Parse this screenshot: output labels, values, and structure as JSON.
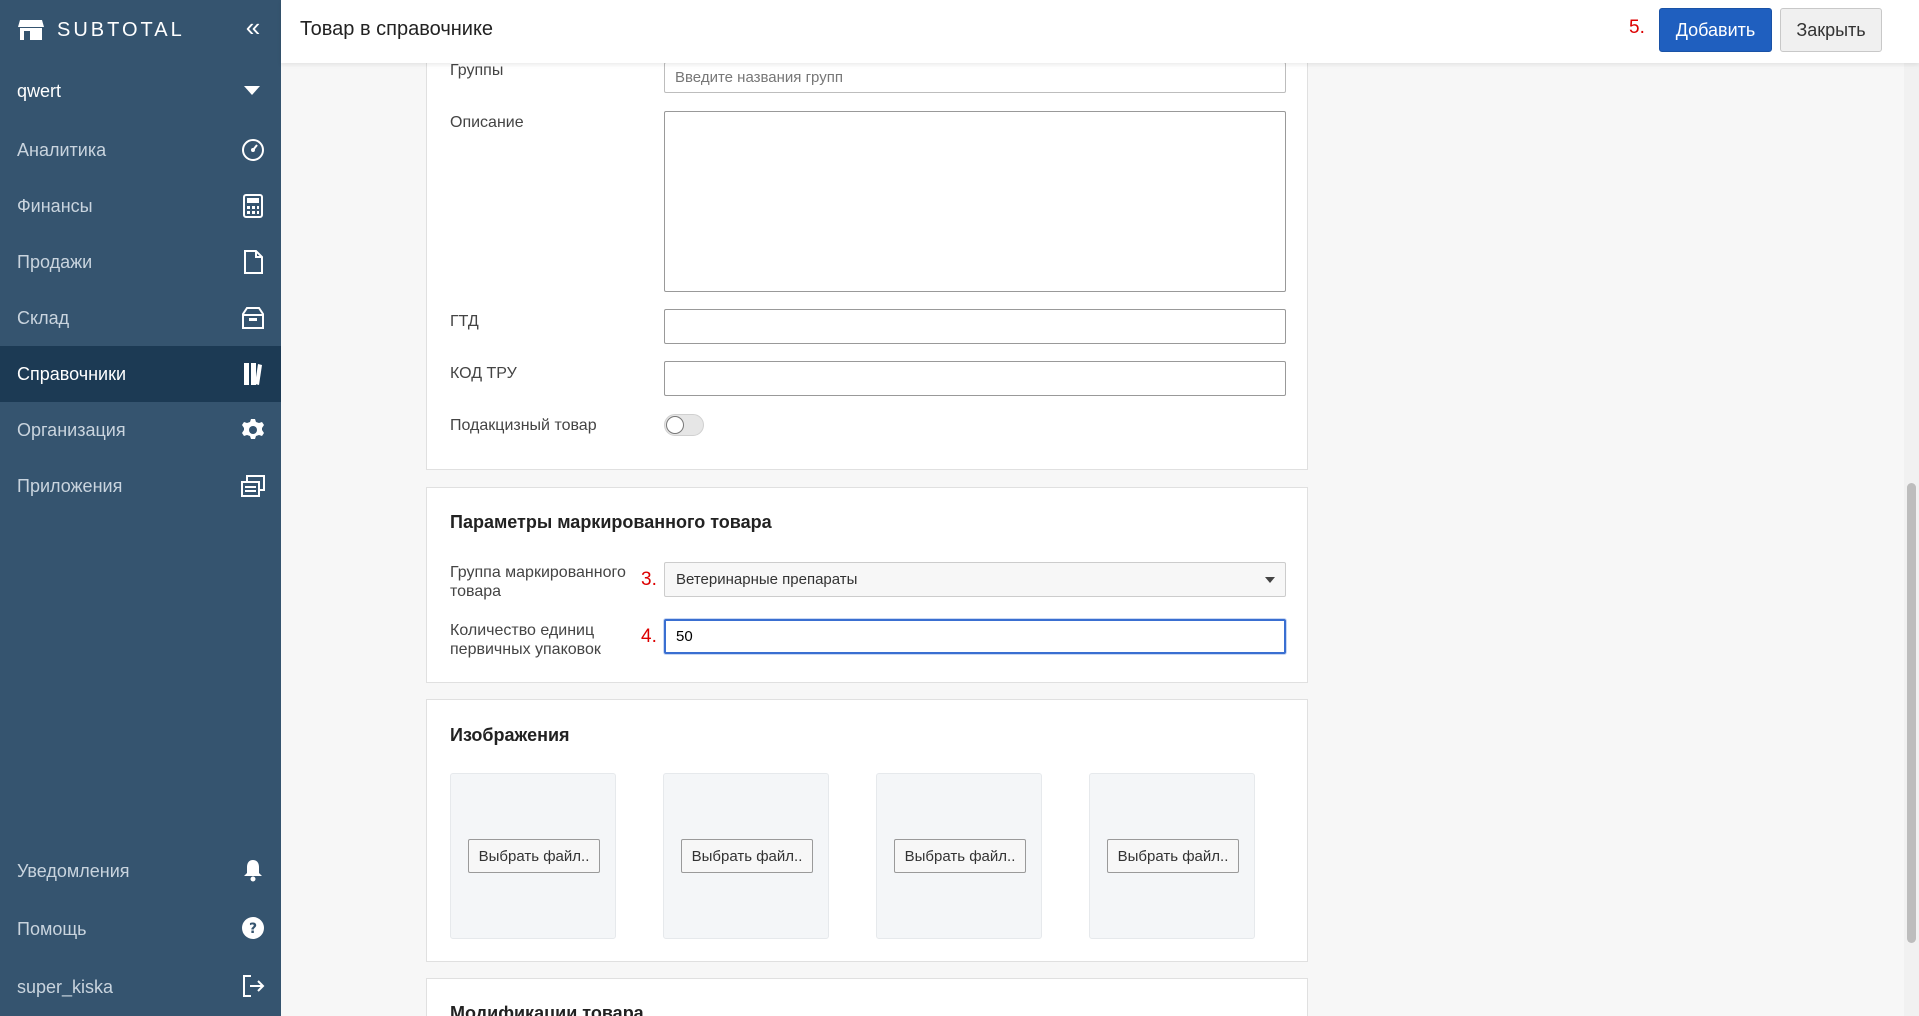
{
  "brand": {
    "name": "SUBTOTAL",
    "logo_icon": "store-icon",
    "collapse_icon": "double-chevron-left-icon"
  },
  "org": {
    "name": "qwert"
  },
  "nav": [
    {
      "label": "Аналитика",
      "icon": "gauge-icon"
    },
    {
      "label": "Финансы",
      "icon": "calculator-icon"
    },
    {
      "label": "Продажи",
      "icon": "document-icon"
    },
    {
      "label": "Склад",
      "icon": "box-icon"
    },
    {
      "label": "Справочники",
      "icon": "book-icon",
      "active": true
    },
    {
      "label": "Организация",
      "icon": "gear-icon"
    },
    {
      "label": "Приложения",
      "icon": "windows-icon"
    }
  ],
  "nav_bottom": [
    {
      "label": "Уведомления",
      "icon": "bell-icon"
    },
    {
      "label": "Помощь",
      "icon": "help-icon"
    },
    {
      "label": "super_kiska",
      "icon": "logout-icon"
    }
  ],
  "header": {
    "title": "Товар в справочнике",
    "step5": "5.",
    "add_label": "Добавить",
    "close_label": "Закрыть"
  },
  "form": {
    "groups_label": "Группы",
    "groups_placeholder": "Введите названия групп",
    "description_label": "Описание",
    "description_value": "",
    "gtd_label": "ГТД",
    "gtd_value": "",
    "tru_label": "КОД ТРУ",
    "tru_value": "",
    "excise_label": "Подакцизный товар",
    "excise_on": false
  },
  "marked": {
    "title": "Параметры маркированного товара",
    "group_label_1": "Группа маркированного",
    "group_label_2": "товара",
    "step3": "3.",
    "group_value": "Ветеринарные препараты",
    "qty_label_1": "Количество единиц",
    "qty_label_2": "первичных упаковок",
    "step4": "4.",
    "qty_value": "50"
  },
  "images": {
    "title": "Изображения",
    "pick_label": "Выбрать файл.."
  },
  "modifications": {
    "title": "Модификации товара"
  },
  "colors": {
    "sidebar": "#35546f",
    "sidebar_active": "#1c3a54",
    "primary": "#1f5fbf",
    "step": "#dd0000"
  }
}
